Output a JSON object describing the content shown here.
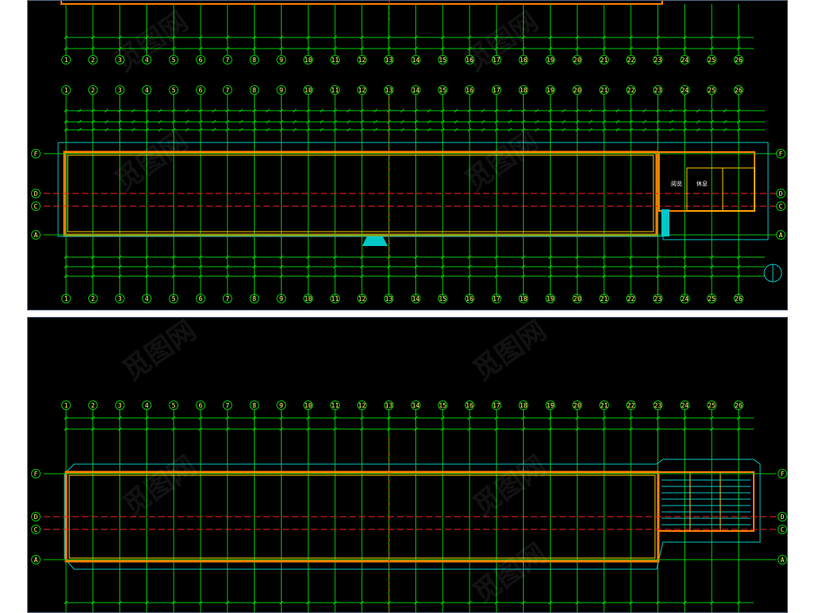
{
  "colors": {
    "background": "#000000",
    "grid_line": "#00c800",
    "axis_line": "#ff2020",
    "wall": "#ff8000",
    "wall_inner": "#ffcc00",
    "outline": "#00c8c8",
    "bubble_text": "#ffff66",
    "dim_text": "#ffffff"
  },
  "top_plan": {
    "column_axes": [
      "1",
      "2",
      "3",
      "4",
      "5",
      "6",
      "7",
      "8",
      "9",
      "10",
      "11",
      "12",
      "13",
      "14",
      "15",
      "16",
      "17",
      "18",
      "19",
      "20",
      "21",
      "22",
      "23",
      "24",
      "25",
      "26"
    ],
    "row_axes": [
      "F",
      "D",
      "C",
      "A"
    ],
    "rooms": [
      "阅览",
      "休息"
    ]
  },
  "bottom_plan": {
    "column_axes": [
      "1",
      "2",
      "3",
      "4",
      "5",
      "6",
      "7",
      "8",
      "9",
      "10",
      "11",
      "12",
      "13",
      "14",
      "15",
      "16",
      "17",
      "18",
      "19",
      "20",
      "21",
      "22",
      "23",
      "24",
      "25",
      "26"
    ],
    "row_axes": [
      "F",
      "D",
      "C",
      "A"
    ]
  }
}
